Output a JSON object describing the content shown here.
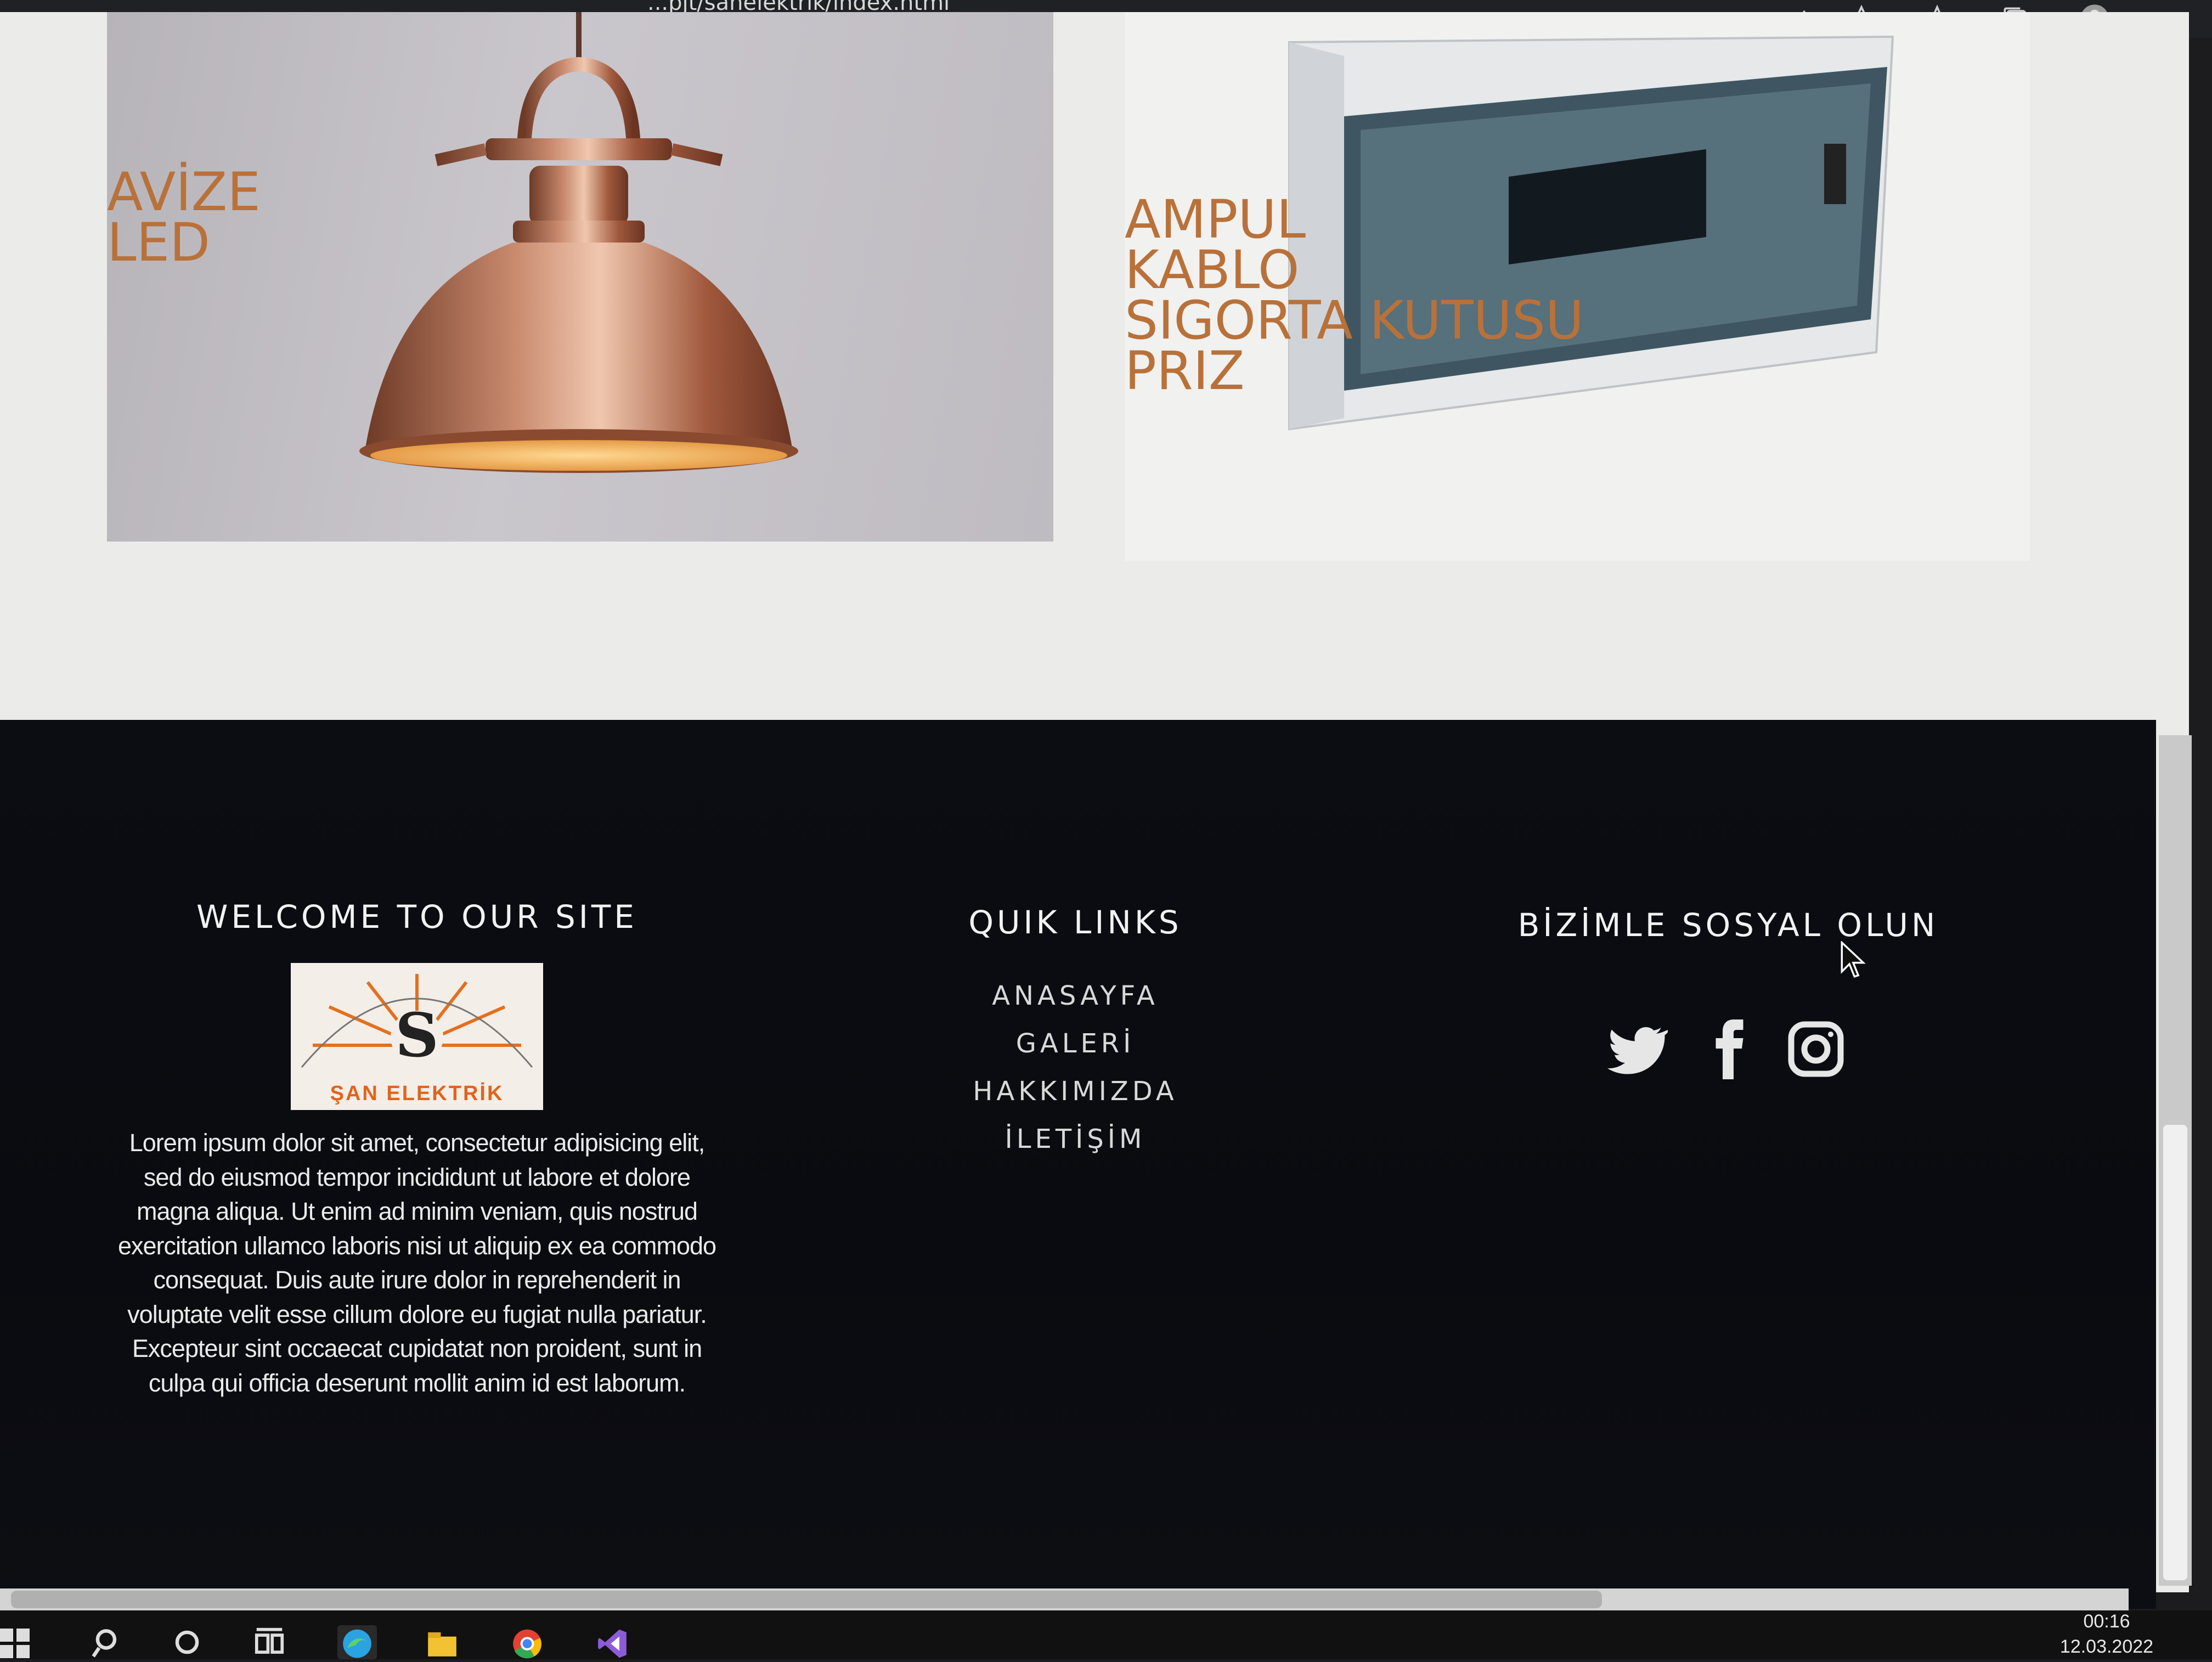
{
  "browser": {
    "url": "...pjt/sanelektrik/index.html",
    "toolbar_icons": [
      "read-aloud-icon",
      "add-favorite-icon",
      "favorites-icon",
      "collections-icon",
      "profile-icon",
      "more-icon"
    ],
    "more_label": "..."
  },
  "products": [
    {
      "lines": [
        "AVİZE",
        "LED"
      ],
      "image": "copper-pendant-lamp"
    },
    {
      "lines": [
        "AMPUL",
        "KABLO",
        "SIGORTA KUTUSU",
        "PRIZ"
      ],
      "image": "fuse-box-panel"
    }
  ],
  "footer": {
    "welcome_title": "WELCOME TO OUR SITE",
    "logo_text": "ŞAN ELEKTRİK",
    "description": "Lorem ipsum dolor sit amet, consectetur adipisicing elit, sed do eiusmod tempor incididunt ut labore et dolore magna aliqua. Ut enim ad minim veniam, quis nostrud exercitation ullamco laboris nisi ut aliquip ex ea commodo consequat. Duis aute irure dolor in reprehenderit in voluptate velit esse cillum dolore eu fugiat nulla pariatur. Excepteur sint occaecat cupidatat non proident, sunt in culpa qui officia deserunt mollit anim id est laborum.",
    "links_title": "QUIK LINKS",
    "links": [
      "ANASAYFA",
      "GALERİ",
      "HAKKIMIZDA",
      "İLETİŞİM"
    ],
    "social_title": "BİZİMLE SOSYAL OLUN",
    "social_icons": [
      "twitter-icon",
      "facebook-icon",
      "instagram-icon"
    ]
  },
  "taskbar": {
    "time": "00:16",
    "date": "12.03.2022",
    "colors": {
      "edge": "#2aa3e0",
      "explorer": "#f2c233",
      "chrome": "#e34133",
      "vs": "#8e5bd8"
    }
  },
  "colors": {
    "accent": "#b9713a",
    "footer_bg": "#0b0d12",
    "text_light": "#f2f2f2"
  }
}
